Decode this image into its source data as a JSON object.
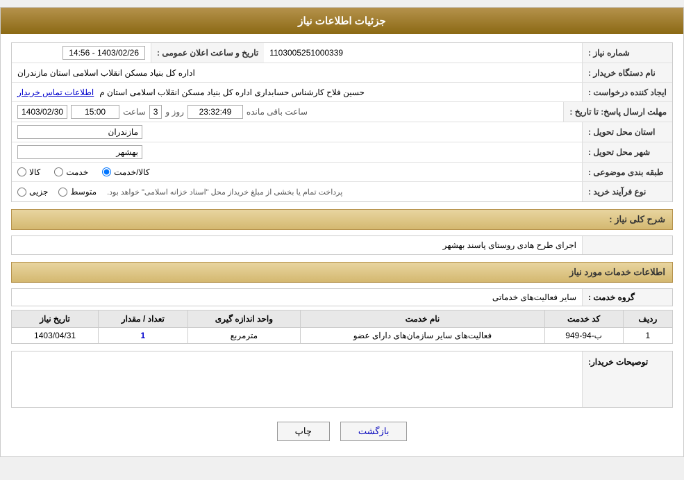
{
  "header": {
    "title": "جزئیات اطلاعات نیاز"
  },
  "fields": {
    "need_number_label": "شماره نیاز :",
    "need_number_value": "1103005251000339",
    "buyer_org_label": "نام دستگاه خریدار :",
    "buyer_org_value": "اداره کل بنیاد مسکن انقلاب اسلامی استان مازندران",
    "creator_label": "ایجاد کننده درخواست :",
    "creator_value": "حسین فلاح کارشناس حسابداری اداره کل بنیاد مسکن انقلاب اسلامی استان م",
    "creator_link": "اطلاعات تماس خریدار",
    "deadline_label": "مهلت ارسال پاسخ: تا تاریخ :",
    "deadline_date": "1403/02/30",
    "deadline_time_label": "ساعت",
    "deadline_time": "15:00",
    "deadline_days_label": "روز و",
    "deadline_days": "3",
    "deadline_remaining_label": "ساعت باقی مانده",
    "deadline_remaining": "23:32:49",
    "delivery_province_label": "استان محل تحویل :",
    "delivery_province_value": "مازندران",
    "delivery_city_label": "شهر محل تحویل :",
    "delivery_city_value": "بهشهر",
    "category_label": "طبقه بندی موضوعی :",
    "category_options": [
      "کالا",
      "خدمت",
      "کالا/خدمت"
    ],
    "category_selected": "کالا/خدمت",
    "purchase_label": "نوع فرآیند خرید :",
    "purchase_options": [
      "جزیی",
      "متوسط"
    ],
    "purchase_note": "پرداخت تمام یا بخشی از مبلغ خریداز محل \"اسناد خزانه اسلامی\" خواهد بود.",
    "announce_label": "تاریخ و ساعت اعلان عمومی :",
    "announce_value": "1403/02/26 - 14:56"
  },
  "need_description": {
    "section_title": "شرح کلی نیاز :",
    "label": "شرح کلی نیاز:",
    "value": "اجرای طرح هادی روستای پاسند بهشهر"
  },
  "services_section": {
    "title": "اطلاعات خدمات مورد نیاز",
    "group_label": "گروه خدمت :",
    "group_value": "سایر فعالیت‌های خدماتی",
    "table": {
      "headers": [
        "ردیف",
        "کد خدمت",
        "نام خدمت",
        "واحد اندازه گیری",
        "تعداد / مقدار",
        "تاریخ نیاز"
      ],
      "rows": [
        {
          "row_num": "1",
          "service_code": "ب-94-949",
          "service_name": "فعالیت‌های سایر سازمان‌های دارای عضو",
          "unit": "مترمربع",
          "quantity": "1",
          "date": "1403/04/31"
        }
      ]
    }
  },
  "buyer_description": {
    "label": "توصیحات خریدار:",
    "value": ""
  },
  "buttons": {
    "print": "چاپ",
    "back": "بازگشت"
  }
}
